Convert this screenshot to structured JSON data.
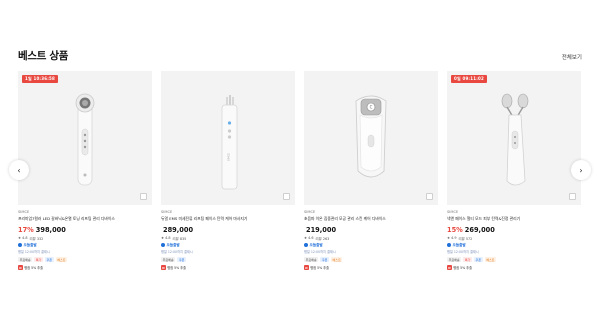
{
  "section": {
    "title": "베스트 상품",
    "view_all": "전체보기"
  },
  "nav": {
    "prev_icon": "‹",
    "next_icon": "›"
  },
  "products": [
    {
      "timer": "1일 10:36:58",
      "brand": "SIMCE",
      "name": "프리미엄7컬러 LED 갈바닉&온열 토닝 리프팅 관리 디바이스",
      "discount": "17%",
      "price": "398,000",
      "rating": "★ 4.8",
      "reviews": "리뷰 332",
      "delivery": "오늘출발",
      "delivery_note": "평일 12:00까지 결제시",
      "tags": [
        "무료배송",
        "특가",
        "쿠폰",
        "베스트"
      ],
      "point_badge": "N",
      "point_text": "평점 5% 추출"
    },
    {
      "timer": "",
      "brand": "SIMCE",
      "name": "듀얼 EMS 미세전류 리프팅 페이스 탄력 케어 마사지기",
      "discount": "",
      "price": "289,000",
      "rating": "★ 4.8",
      "reviews": "리뷰 835",
      "delivery": "오늘출발",
      "delivery_note": "평일 12:00까지 결제시",
      "tags": [
        "무료배송",
        "쿠폰"
      ],
      "point_badge": "N",
      "point_text": "평점 5% 추출"
    },
    {
      "timer": "",
      "brand": "SIMCE",
      "name": "초음파 이온 집중관리 모공 관리 스킨 케어 디바이스",
      "discount": "",
      "price": "219,000",
      "rating": "★ 4.6",
      "reviews": "리뷰 263",
      "delivery": "오늘출발",
      "delivery_note": "평일 12:00까지 결제시",
      "tags": [
        "무료배송",
        "쿠폰",
        "베스트"
      ],
      "point_badge": "N",
      "point_text": "평점 5% 추출"
    },
    {
      "timer": "0일 09:11:02",
      "brand": "SIMCE",
      "name": "넥앤 페이스 멀티 모드 피부 탄력&진정 관리기",
      "discount": "15%",
      "price": "269,000",
      "rating": "★ 4.9",
      "reviews": "리뷰 572",
      "delivery": "오늘출발",
      "delivery_note": "평일 12:00까지 결제시",
      "tags": [
        "무료배송",
        "특가",
        "쿠폰",
        "베스트"
      ],
      "point_badge": "N",
      "point_text": "평점 5% 추출"
    }
  ]
}
